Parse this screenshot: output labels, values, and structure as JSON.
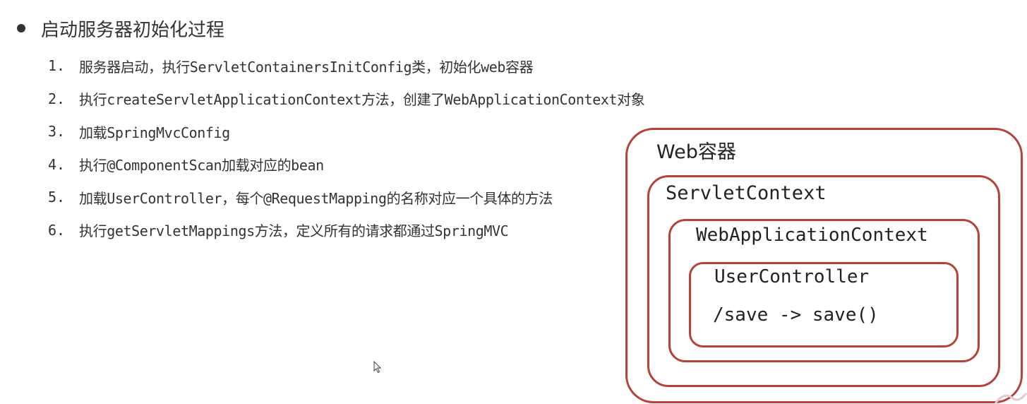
{
  "heading": "启动服务器初始化过程",
  "steps": [
    {
      "num": "1.",
      "text": "服务器启动，执行ServletContainersInitConfig类，初始化web容器"
    },
    {
      "num": "2.",
      "text": "执行createServletApplicationContext方法，创建了WebApplicationContext对象"
    },
    {
      "num": "3.",
      "text": "加载SpringMvcConfig"
    },
    {
      "num": "4.",
      "text": "执行@ComponentScan加载对应的bean"
    },
    {
      "num": "5.",
      "text": "加载UserController，每个@RequestMapping的名称对应一个具体的方法"
    },
    {
      "num": "6.",
      "text": "执行getServletMappings方法，定义所有的请求都通过SpringMVC"
    }
  ],
  "diagram": {
    "web_container": "Web容器",
    "servlet_context": "ServletContext",
    "web_app_context": "WebApplicationContext",
    "user_controller": "UserController",
    "mapping": "/save -> save()"
  },
  "colors": {
    "box_border": "#b5433a",
    "text": "#333333"
  }
}
